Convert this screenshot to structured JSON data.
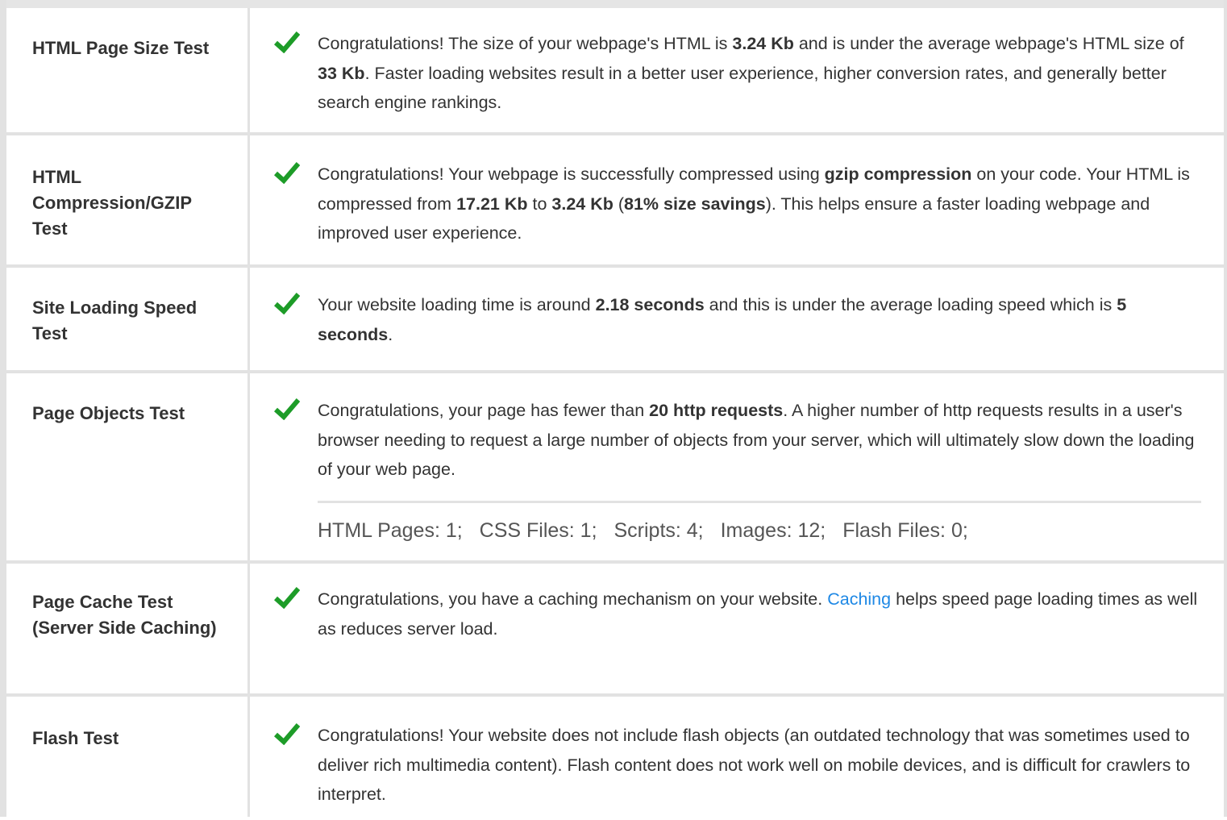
{
  "colors": {
    "check": "#1d9c28",
    "link": "#1e88e5",
    "border": "#e2e2e2"
  },
  "rows": [
    {
      "label": "HTML Page Size Test",
      "icon": "checkmark-icon",
      "t0": "Congratulations! The size of your webpage's HTML is ",
      "b0": "3.24 Kb",
      "t1": " and is under the average webpage's HTML size of ",
      "b1": "33 Kb",
      "t2": ". Faster loading websites result in a better user experience, higher conversion rates, and generally better search engine rankings."
    },
    {
      "label": "HTML Compression/GZIP Test",
      "icon": "checkmark-icon",
      "t0": "Congratulations! Your webpage is successfully compressed using ",
      "b0": "gzip compression",
      "t1": " on your code. Your HTML is compressed from ",
      "b1": "17.21 Kb",
      "t2": " to ",
      "b2": "3.24 Kb",
      "t3": " (",
      "b3": "81% size savings",
      "t4": "). This helps ensure a faster loading webpage and improved user experience."
    },
    {
      "label": "Site Loading Speed Test",
      "icon": "checkmark-icon",
      "t0": "Your website loading time is around ",
      "b0": "2.18 seconds",
      "t1": " and this is under the average loading speed which is ",
      "b1": "5 seconds",
      "t2": "."
    },
    {
      "label": "Page Objects Test",
      "icon": "checkmark-icon",
      "t0": "Congratulations, your page has fewer than ",
      "b0": "20 http requests",
      "t1": ". A higher number of http requests results in a user's browser needing to request a large number of objects from your server, which will ultimately slow down the loading of your web page.",
      "counts": [
        "HTML Pages: 1;",
        "CSS Files: 1;",
        "Scripts: 4;",
        "Images: 12;",
        "Flash Files: 0;"
      ]
    },
    {
      "label": "Page Cache Test (Server Side Caching)",
      "icon": "checkmark-icon",
      "t0": "Congratulations, you have a caching mechanism on your website. ",
      "link": "Caching",
      "t1": " helps speed page loading times as well as reduces server load."
    },
    {
      "label": "Flash Test",
      "icon": "checkmark-icon",
      "t0": "Congratulations! Your website does not include flash objects (an outdated technology that was sometimes used to deliver rich multimedia content). Flash content does not work well on mobile devices, and is difficult for crawlers to interpret."
    }
  ]
}
